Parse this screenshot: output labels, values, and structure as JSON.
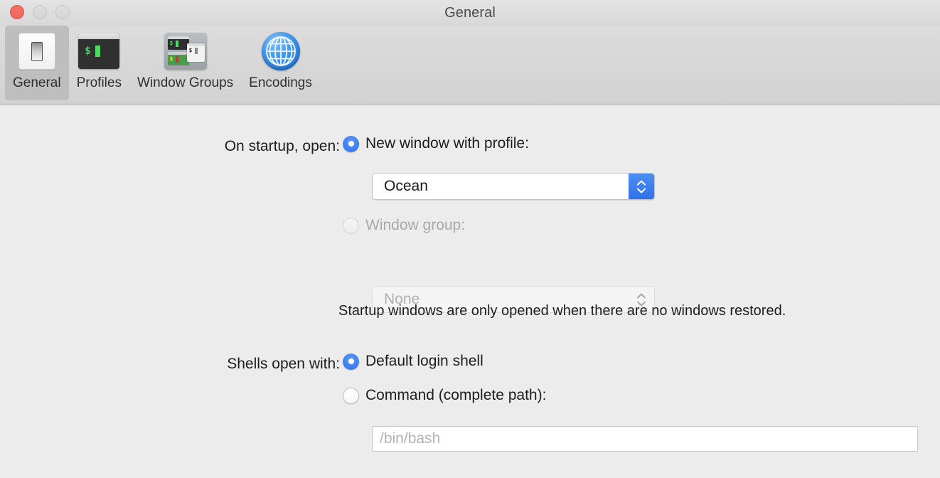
{
  "window": {
    "title": "General",
    "traffic_lights": [
      {
        "name": "close",
        "color": "#ec6a60",
        "enabled": true
      },
      {
        "name": "minimize",
        "color": "#d4d4d4",
        "enabled": false
      },
      {
        "name": "zoom",
        "color": "#d4d4d4",
        "enabled": false
      }
    ]
  },
  "toolbar": {
    "tabs": [
      {
        "id": "general",
        "label": "General",
        "icon": "light-switch-icon",
        "selected": true
      },
      {
        "id": "profiles",
        "label": "Profiles",
        "icon": "terminal-window-icon",
        "selected": false
      },
      {
        "id": "window-groups",
        "label": "Window Groups",
        "icon": "window-group-icon",
        "selected": false
      },
      {
        "id": "encodings",
        "label": "Encodings",
        "icon": "globe-icon",
        "selected": false
      }
    ]
  },
  "startup": {
    "label": "On startup, open:",
    "options": [
      {
        "id": "new-window-with-profile",
        "text": "New window with profile:",
        "selected": true,
        "disabled": false
      },
      {
        "id": "window-group",
        "text": "Window group:",
        "selected": false,
        "disabled": true
      }
    ],
    "profile_select": {
      "value": "Ocean",
      "disabled": false,
      "arrow_color": "#3b7ef0"
    },
    "group_select": {
      "value": "None",
      "disabled": true
    },
    "hint": "Startup windows are only opened when there are no windows restored."
  },
  "shells": {
    "label": "Shells open with:",
    "options": [
      {
        "id": "default-login-shell",
        "text": "Default login shell",
        "selected": true
      },
      {
        "id": "command-complete-path",
        "text": "Command (complete path):",
        "selected": false
      }
    ],
    "command_field": {
      "value": "",
      "placeholder": "/bin/bash"
    }
  },
  "icon_glyphs": {
    "prompt": "$",
    "chevron_up": "chevron-up-icon",
    "chevron_down": "chevron-down-icon"
  },
  "colors": {
    "accent": "#3b7ef0",
    "window_bg": "#ececec",
    "toolbar_bg": "#d6d6d6",
    "selected_tab_bg": "#bebebe",
    "text": "#1d1d1d",
    "disabled_text": "#a9a9a9",
    "terminal_green": "#4cd964"
  }
}
